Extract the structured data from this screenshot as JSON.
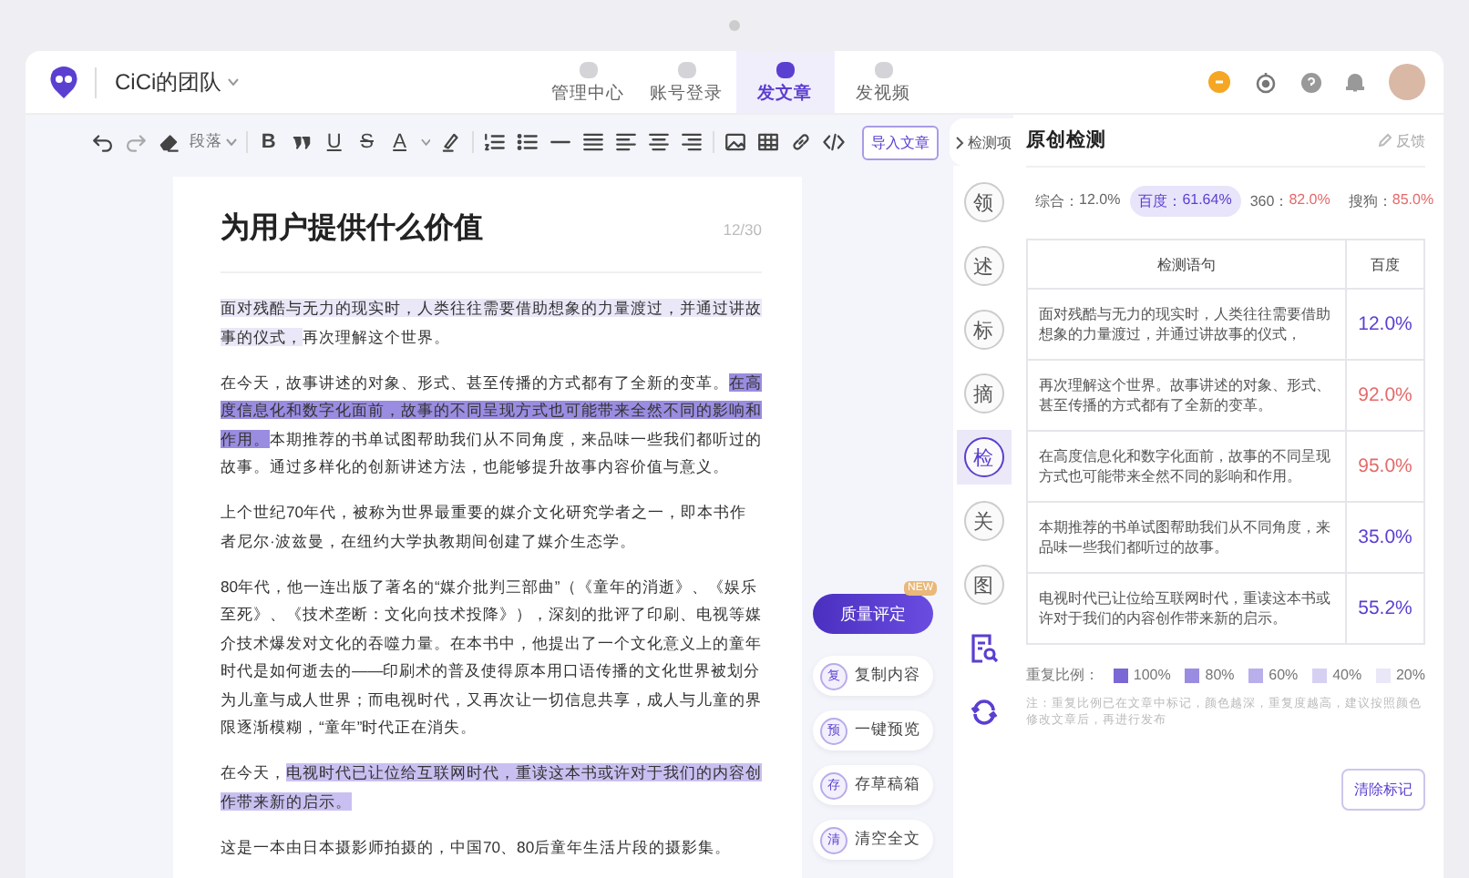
{
  "header": {
    "team": "CiCi的团队",
    "nav": [
      {
        "label": "管理中心",
        "selected": false
      },
      {
        "label": "账号登录",
        "selected": false
      },
      {
        "label": "发文章",
        "selected": true
      },
      {
        "label": "发视频",
        "selected": false
      }
    ]
  },
  "toolbar": [
    {
      "kind": "undo"
    },
    {
      "kind": "redo"
    },
    {
      "kind": "eraser"
    },
    {
      "kind": "dropdown",
      "text": "段落"
    },
    {
      "kind": "sep"
    },
    {
      "kind": "bold",
      "text": "B"
    },
    {
      "kind": "quote"
    },
    {
      "kind": "underline",
      "text": "U"
    },
    {
      "kind": "strike",
      "text": "S"
    },
    {
      "kind": "font-color",
      "text": "A"
    },
    {
      "kind": "highlighter"
    },
    {
      "kind": "sep"
    },
    {
      "kind": "ordered-list"
    },
    {
      "kind": "bullet-list"
    },
    {
      "kind": "hr"
    },
    {
      "kind": "justify"
    },
    {
      "kind": "align-left"
    },
    {
      "kind": "align-center"
    },
    {
      "kind": "align-right"
    },
    {
      "kind": "sep"
    },
    {
      "kind": "image"
    },
    {
      "kind": "table"
    },
    {
      "kind": "link"
    },
    {
      "kind": "code"
    },
    {
      "kind": "button",
      "text": "导入文章"
    }
  ],
  "article": {
    "title": "为用户提供什么价值",
    "counter": "12/30",
    "paragraphs": [
      [
        {
          "text": "面对残酷与无力的现实时，人类往往需要借助想象的力量渡过，并通过讲故事的仪式，",
          "color": "#eae7f8"
        },
        {
          "text": "再次理解这个世界。"
        }
      ],
      [
        {
          "text": "在今天，故事讲述的对象、形式、甚至传播的方式都有了全新的变革。"
        },
        {
          "text": "在高度信息化和数字化面前，故事的不同呈现方式也可能带来全然不同的影响和作用。",
          "color": "#9a8ce0"
        },
        {
          "text": "本期推荐的书单试图帮助我们从不同角度，来品味一些我们都听过的故事。通过多样化的创新讲述方法，也能够提升故事内容价值与意义。"
        }
      ],
      [
        {
          "text": "上个世纪70年代，被称为世界最重要的媒介文化研究学者之一，即本书作者尼尔·波兹曼，在纽约大学执教期间创建了媒介生态学。"
        }
      ],
      [
        {
          "text": "80年代，他一连出版了著名的“媒介批判三部曲”（《童年的消逝》、《娱乐至死》、《技术垄断：文化向技术投降》），深刻的批评了印刷、电视等媒介技术爆发对文化的吞噬力量。在本书中，他提出了一个文化意义上的童年时代是如何逝去的——印刷术的普及使得原本用口语传播的文化世界被划分为儿童与成人世界；而电视时代，又再次让一切信息共享，成人与儿童的界限逐渐模糊，“童年”时代正在消失。"
        }
      ],
      [
        {
          "text": "在今天，"
        },
        {
          "text": "电视时代已让位给互联网时代，重读这本书或许对于我们的内容创作带来新的启示。",
          "color": "#c9c0f1"
        }
      ],
      [
        {
          "text": "这是一本由日本摄影师拍摄的，中国70、80后童年生活片段的摄影集。"
        }
      ]
    ]
  },
  "actions": [
    {
      "label": "质量评定",
      "kind": "primary",
      "badge": "NEW"
    },
    {
      "label": "复制内容",
      "kind": "chip",
      "char": "复"
    },
    {
      "label": "一键预览",
      "kind": "chip",
      "char": "预"
    },
    {
      "label": "存草稿箱",
      "kind": "chip",
      "char": "存"
    },
    {
      "label": "清空全文",
      "kind": "chip",
      "char": "清"
    }
  ],
  "side_tab": "检测项",
  "side_tools": [
    {
      "kind": "char",
      "char": "领",
      "selected": false
    },
    {
      "kind": "char",
      "char": "述",
      "selected": false
    },
    {
      "kind": "char",
      "char": "标",
      "selected": false
    },
    {
      "kind": "char",
      "char": "摘",
      "selected": false
    },
    {
      "kind": "char",
      "char": "检",
      "selected": true
    },
    {
      "kind": "char",
      "char": "关",
      "selected": false
    },
    {
      "kind": "char",
      "char": "图",
      "selected": false
    },
    {
      "kind": "doc-search",
      "selected": false
    },
    {
      "kind": "refresh",
      "selected": false
    }
  ],
  "panel": {
    "title": "原创检测",
    "feedback": "反馈",
    "scores": [
      {
        "label": "综合：",
        "value": "12.0%",
        "selected": false,
        "high": false
      },
      {
        "label": "百度：",
        "value": "61.64%",
        "selected": true,
        "high": false
      },
      {
        "label": "360：",
        "value": "82.0%",
        "selected": false,
        "high": true
      },
      {
        "label": "搜狗：",
        "value": "85.0%",
        "selected": false,
        "high": true
      }
    ],
    "table": {
      "columns": [
        "检测语句",
        "百度"
      ],
      "rows": [
        {
          "sentence": "面对残酷与无力的现实时，人类往往需要借助想象的力量渡过，并通过讲故事的仪式，",
          "score": "12.0%",
          "high": false
        },
        {
          "sentence": "再次理解这个世界。故事讲述的对象、形式、甚至传播的方式都有了全新的变革。",
          "score": "92.0%",
          "high": true
        },
        {
          "sentence": "在高度信息化和数字化面前，故事的不同呈现方式也可能带来全然不同的影响和作用。",
          "score": "95.0%",
          "high": true
        },
        {
          "sentence": "本期推荐的书单试图帮助我们从不同角度，来品味一些我们都听过的故事。",
          "score": "35.0%",
          "high": false
        },
        {
          "sentence": "电视时代已让位给互联网时代，重读这本书或许对于我们的内容创作带来新的启示。",
          "score": "55.2%",
          "high": false
        }
      ]
    },
    "legend_label": "重复比例：",
    "legend": [
      {
        "label": "100%",
        "color": "#7b68d4"
      },
      {
        "label": "80%",
        "color": "#9a8ce0"
      },
      {
        "label": "60%",
        "color": "#b9afea"
      },
      {
        "label": "40%",
        "color": "#d6d0f2"
      },
      {
        "label": "20%",
        "color": "#eae7f8"
      }
    ],
    "note": "注：重复比例已在文章中标记，颜色越深，重复度越高，建议按照颜色修改文章后，再进行发布",
    "clear_button": "清除标记"
  }
}
